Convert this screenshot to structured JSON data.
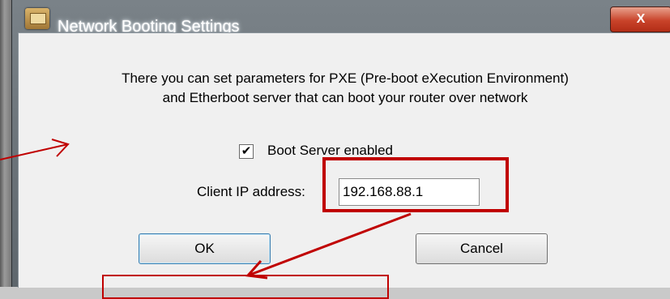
{
  "dialog": {
    "title": "Network Booting Settings",
    "close_label": "X",
    "description_line1": "There you can set parameters for PXE (Pre-boot eXecution Environment)",
    "description_line2": "and Etherboot server that can boot your router over network",
    "checkbox_label": "Boot Server enabled",
    "checkbox_mark": "✔",
    "ip_label": "Client IP address:",
    "ip_value": "192.168.88.1",
    "ok_label": "OK",
    "cancel_label": "Cancel"
  },
  "annotation": {
    "color": "#c00000"
  }
}
